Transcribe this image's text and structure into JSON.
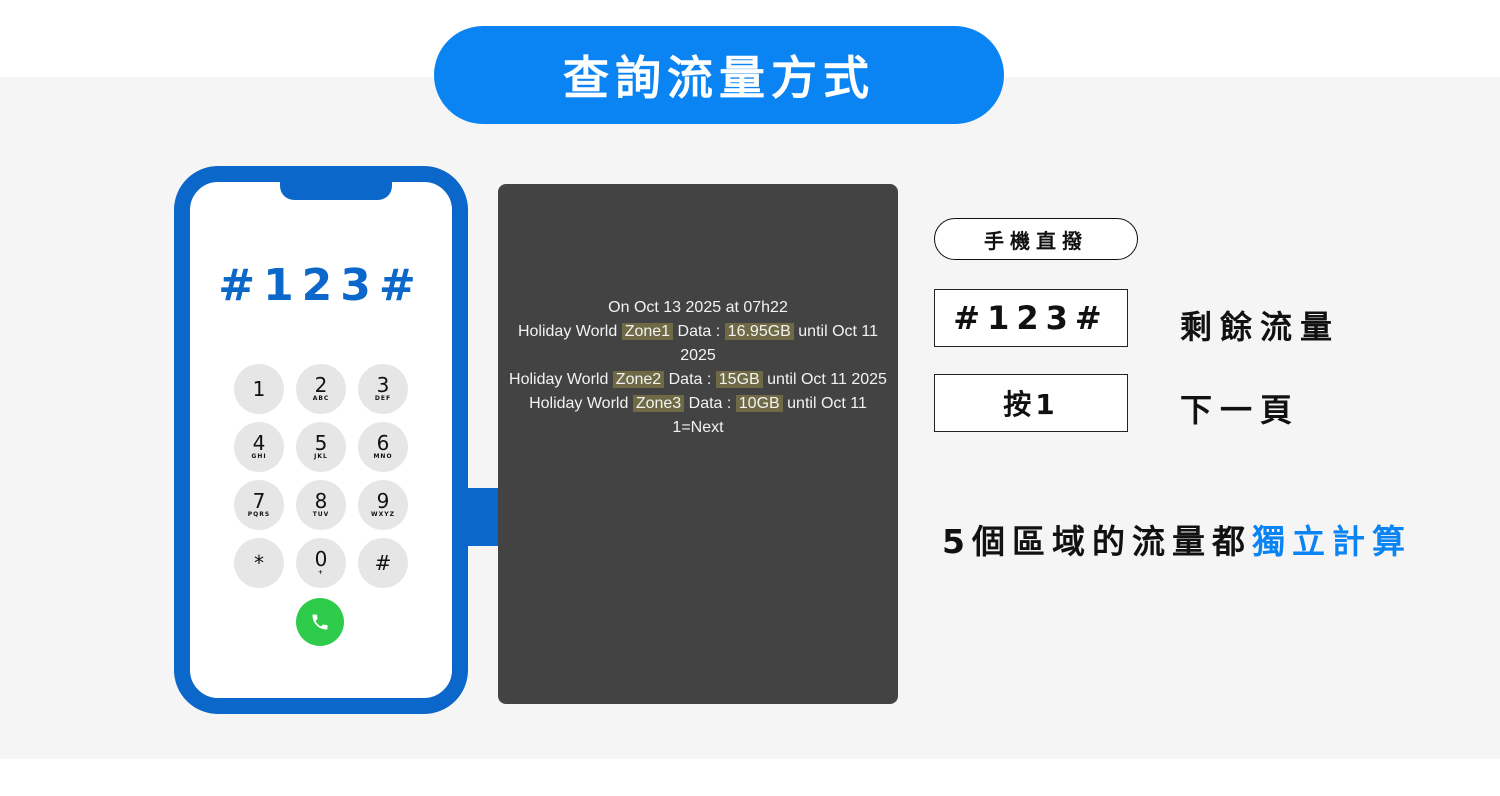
{
  "title": "查詢流量方式",
  "phone": {
    "dial_code": "#123#",
    "keys": [
      {
        "digit": "1",
        "letters": ""
      },
      {
        "digit": "2",
        "letters": "ABC"
      },
      {
        "digit": "3",
        "letters": "DEF"
      },
      {
        "digit": "4",
        "letters": "GHI"
      },
      {
        "digit": "5",
        "letters": "JKL"
      },
      {
        "digit": "6",
        "letters": "MNO"
      },
      {
        "digit": "7",
        "letters": "PQRS"
      },
      {
        "digit": "8",
        "letters": "TUV"
      },
      {
        "digit": "9",
        "letters": "WXYZ"
      },
      {
        "digit": "*",
        "letters": ""
      },
      {
        "digit": "0",
        "letters": "+"
      },
      {
        "digit": "#",
        "letters": ""
      }
    ],
    "call_icon": "phone-icon"
  },
  "ussd": {
    "line1": "On Oct 13 2025 at 07h22",
    "prefix": "Holiday World",
    "data_label": "Data :",
    "until": "until",
    "zones": [
      {
        "zone": "Zone1",
        "amount": "16.95GB",
        "expiry": "Oct 11 2025"
      },
      {
        "zone": "Zone2",
        "amount": "15GB",
        "expiry": "Oct 11 2025"
      },
      {
        "zone": "Zone3",
        "amount": "10GB",
        "expiry": "Oct 11"
      }
    ],
    "next": "1=Next"
  },
  "method_tag": "手機直撥",
  "rows": [
    {
      "code": "#123#",
      "meaning": "剩餘流量"
    },
    {
      "code": "按1",
      "meaning": "下一頁"
    }
  ],
  "note": {
    "black": "5個區域的流量都",
    "blue": "獨立計算"
  },
  "colors": {
    "accent": "#0a84f2",
    "phone_frame": "#0b67c9",
    "call_green": "#2ecc4a",
    "screen_bg": "#434343",
    "highlight": "#6f6a45"
  }
}
